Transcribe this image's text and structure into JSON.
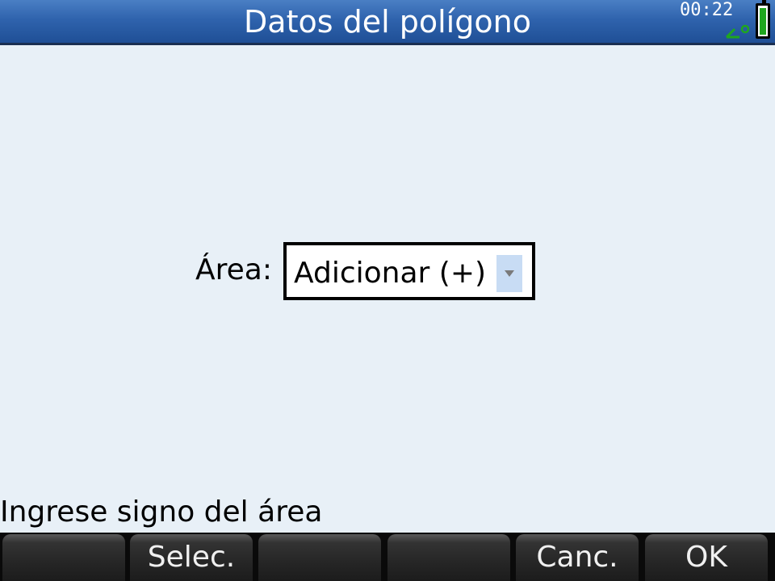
{
  "header": {
    "title": "Datos del polígono",
    "time": "00:22",
    "angle_mode_icon": "degree-angle-icon",
    "battery_icon": "battery-icon"
  },
  "form": {
    "area_label": "Área:",
    "area_value": "Adicionar (+)",
    "dropdown_icon": "chevron-down-icon"
  },
  "help_text": "Ingrese signo del área",
  "softkeys": [
    "",
    "Selec.",
    "",
    "",
    "Canc.",
    "OK"
  ],
  "colors": {
    "titlebar": "#2f63ad",
    "background": "#e8f0f7",
    "angle_indicator": "#1fa61f"
  }
}
